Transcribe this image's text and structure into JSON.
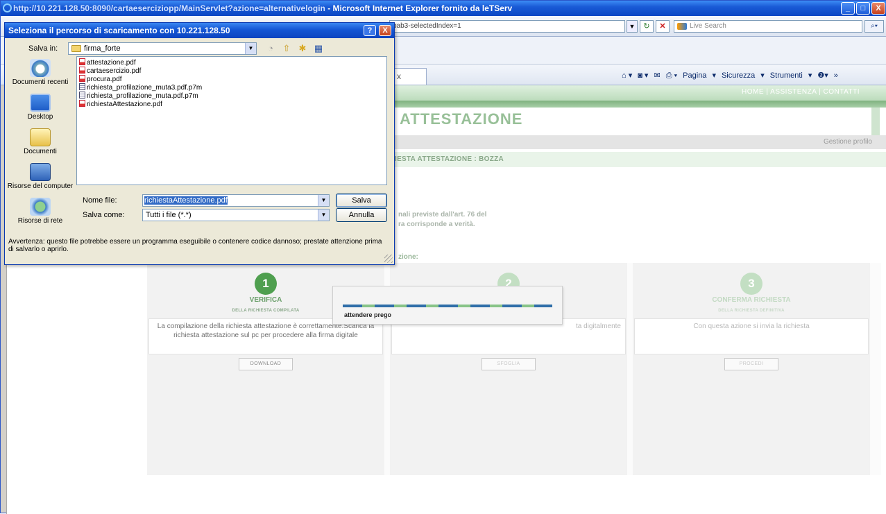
{
  "ie": {
    "title": "http://10.221.128.50:8090/cartaesercizio​pp/MainServlet?azione=alternativelogin",
    "title_suffix": " - Microsoft Internet Explorer fornito da leTServ",
    "address_fragment": "bab3-selectedIndex=1",
    "search_placeholder": "Live Search",
    "tab_close": "x",
    "cmd_pagina": "Pagina",
    "cmd_sicurezza": "Sicurezza",
    "cmd_strumenti": "Strumenti",
    "window_minimize": "_",
    "window_maximize": "□",
    "window_close": "X"
  },
  "page": {
    "top_links": "HOME | ASSISTENZA | CONTATTI",
    "title": "ATTESTAZIONE",
    "nav_item": "Gestione profilo",
    "status": "IESTA ATTESTAZIONE : BOZZA",
    "decl_line1": "nali previste dall'art. 76 del",
    "decl_line2": "ra corrisponde a verità.",
    "steps_heading": "zione:",
    "steps": [
      {
        "number": "1",
        "title": "VERIFICA",
        "subtitle": "DELLA RICHIESTA COMPILATA",
        "desc": "La compilazione della richiesta attestazione è correttamente.Scarica la richiesta attestazione sul pc per procedere alla firma digitale",
        "button": "DOWNLOAD"
      },
      {
        "number": "2",
        "title": "",
        "subtitle": "",
        "desc": "ta digitalmente",
        "button": "SFOGLIA"
      },
      {
        "number": "3",
        "title": "CONFERMA RICHIESTA",
        "subtitle": "DELLA RICHIESTA DEFINITIVA",
        "desc": "Con questa azione si invia la richiesta",
        "button": "PROCEDI"
      }
    ]
  },
  "wait": {
    "text": "attendere prego"
  },
  "dialog": {
    "title": "Seleziona il percorso di scaricamento con 10.221.128.50",
    "help": "?",
    "close": "X",
    "save_in_label": "Salva in:",
    "save_in_value": "firma_forte",
    "places": [
      {
        "label": "Documenti recenti",
        "icon": "recent-documents-icon"
      },
      {
        "label": "Desktop",
        "icon": "desktop-icon"
      },
      {
        "label": "Documenti",
        "icon": "documents-folder-icon"
      },
      {
        "label": "Risorse del computer",
        "icon": "my-computer-icon"
      },
      {
        "label": "Risorse di rete",
        "icon": "network-icon"
      }
    ],
    "files": [
      {
        "name": "attestazione.pdf",
        "type": "pdf"
      },
      {
        "name": "cartaesercizio.pdf",
        "type": "pdf"
      },
      {
        "name": "procura.pdf",
        "type": "pdf"
      },
      {
        "name": "richiesta_profilazione_muta3.pdf.p7m",
        "type": "p7m"
      },
      {
        "name": "richiesta_profilazione_muta.pdf.p7m",
        "type": "p7m"
      },
      {
        "name": "richiestaAttestazione.pdf",
        "type": "pdf"
      }
    ],
    "filename_label": "Nome file:",
    "filename_value": "richiestaAttestazione.pdf",
    "savetype_label": "Salva come:",
    "savetype_value": "Tutti i file (*.*)",
    "save_button": "Salva",
    "cancel_button": "Annulla",
    "warning": "Avvertenza: questo file potrebbe essere un programma eseguibile o contenere codice dannoso; prestate attenzione prima di salvarlo o aprirlo."
  }
}
